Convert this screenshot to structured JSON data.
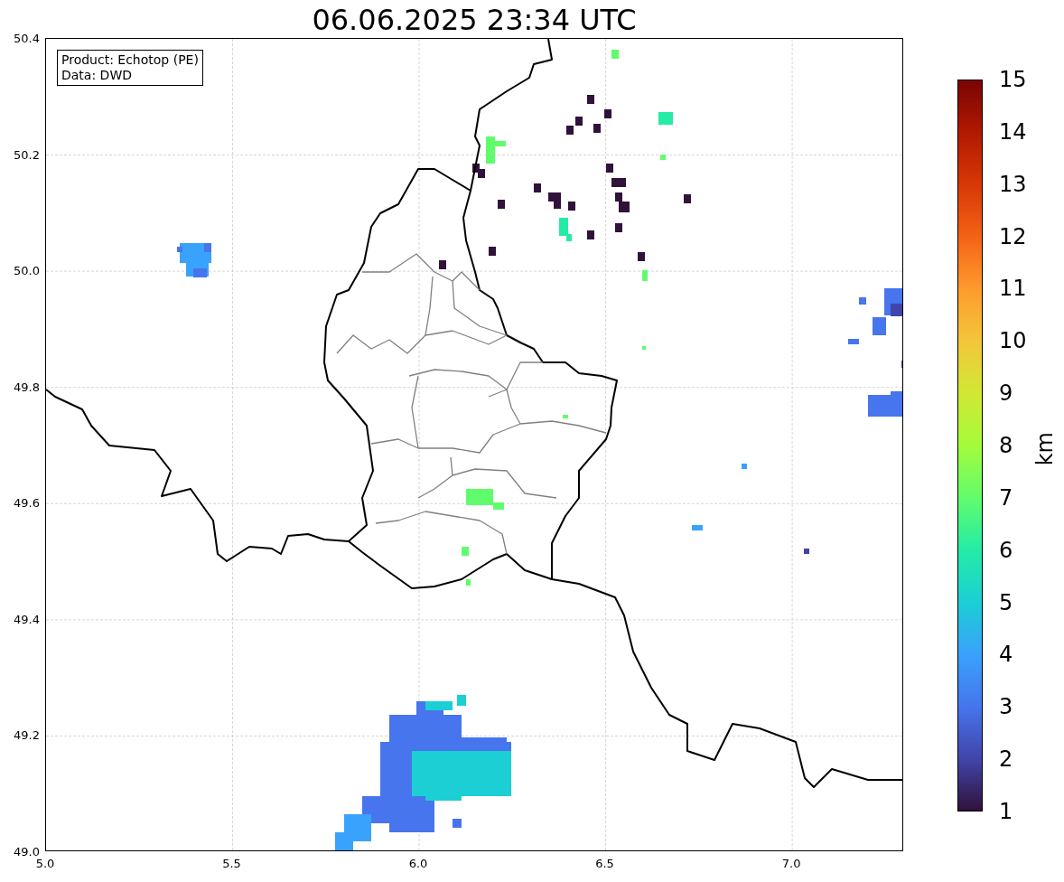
{
  "title": "06.06.2025 23:34 UTC",
  "legend": {
    "lines": [
      "Product: Echotop (PE)",
      "Data: DWD"
    ]
  },
  "map": {
    "x_ticks": [
      "5.0",
      "5.5",
      "6.0",
      "6.5",
      "7.0"
    ],
    "y_ticks": [
      "50.4",
      "50.2",
      "50.0",
      "49.8",
      "49.6",
      "49.4",
      "49.2",
      "49.0"
    ]
  },
  "colorbar": {
    "label": "km",
    "ticks": [
      "15",
      "14",
      "13",
      "12",
      "11",
      "10",
      "9",
      "8",
      "7",
      "6",
      "5",
      "4",
      "3",
      "2",
      "1"
    ]
  }
}
